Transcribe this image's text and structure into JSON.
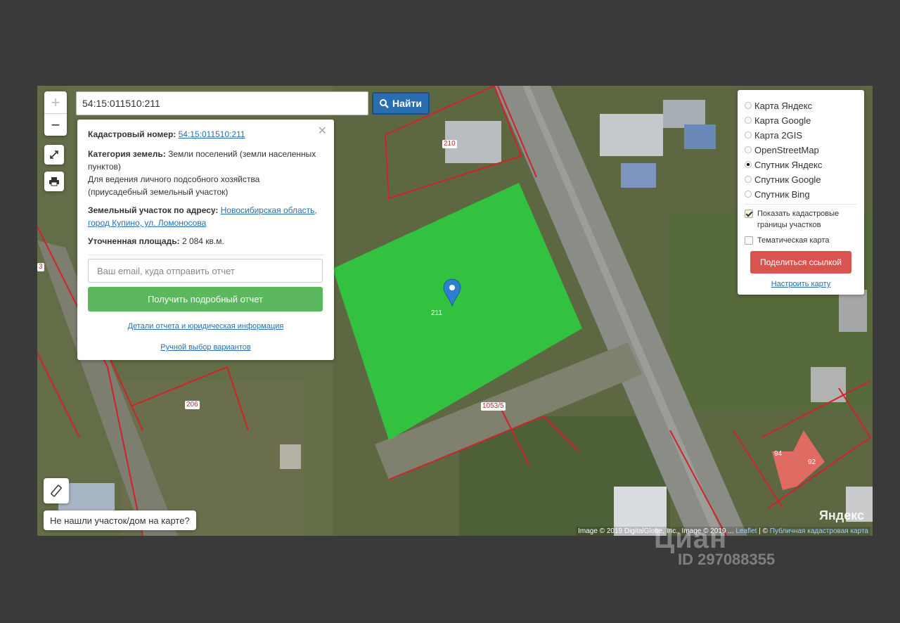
{
  "search": {
    "value": "54:15:011510:211",
    "button_label": "Найти"
  },
  "zoom": {
    "plus": "+",
    "minus": "−"
  },
  "info": {
    "cadastral_label": "Кадастровый номер:",
    "cadastral_value": "54:15:011510:211",
    "category_label": "Категория земель:",
    "category_value": "Земли поселений (земли населенных пунктов)",
    "usage": "Для ведения личного подсобного хозяйства (приусадебный земельный участок)",
    "address_label": "Земельный участок по адресу:",
    "address_value": "Новосибирская область, город Купино, ул. Ломоносова",
    "area_label": "Уточненная площадь:",
    "area_value": "2 084 кв.м.",
    "email_placeholder": "Ваш email, куда отправить отчет",
    "report_button": "Получить подробный отчет",
    "details_link": "Детали отчета и юридическая информация",
    "manual_link": "Ручной выбор вариантов"
  },
  "layers": {
    "options": [
      {
        "label": "Карта Яндекс",
        "selected": false
      },
      {
        "label": "Карта Google",
        "selected": false
      },
      {
        "label": "Карта 2GIS",
        "selected": false
      },
      {
        "label": "OpenStreetMap",
        "selected": false
      },
      {
        "label": "Спутник Яндекс",
        "selected": true
      },
      {
        "label": "Спутник Google",
        "selected": false
      },
      {
        "label": "Спутник Bing",
        "selected": false
      }
    ],
    "show_borders": "Показать кадастровые границы участков",
    "show_borders_checked": true,
    "thematic": "Тематическая карта",
    "thematic_checked": false,
    "share_button": "Поделиться ссылкой",
    "setup_link": "Настроить карту"
  },
  "parcel_labels": {
    "p210": "210",
    "p211": "211",
    "p206": "206",
    "p1053": "1053/5",
    "p94": "94",
    "p92": "92",
    "p3": "3"
  },
  "not_found": "Не нашли участок/дом на карте?",
  "attribution": {
    "imagery": "Image © 2019 DigitalGlobe, Inc., Image © 2019 ...",
    "leaflet": "Leaflet",
    "sep": " | © ",
    "cadastre": "Публичная кадастровая карта"
  },
  "yandex_logo": "Яндекс",
  "watermark": {
    "brand": "Циан",
    "id": "ID 297088355"
  },
  "colors": {
    "parcel_fill": "#2ecc40",
    "border_red": "#d0222a",
    "find_button": "#2a6eb0",
    "report_button": "#5cb85c",
    "share_button": "#d9534f"
  }
}
